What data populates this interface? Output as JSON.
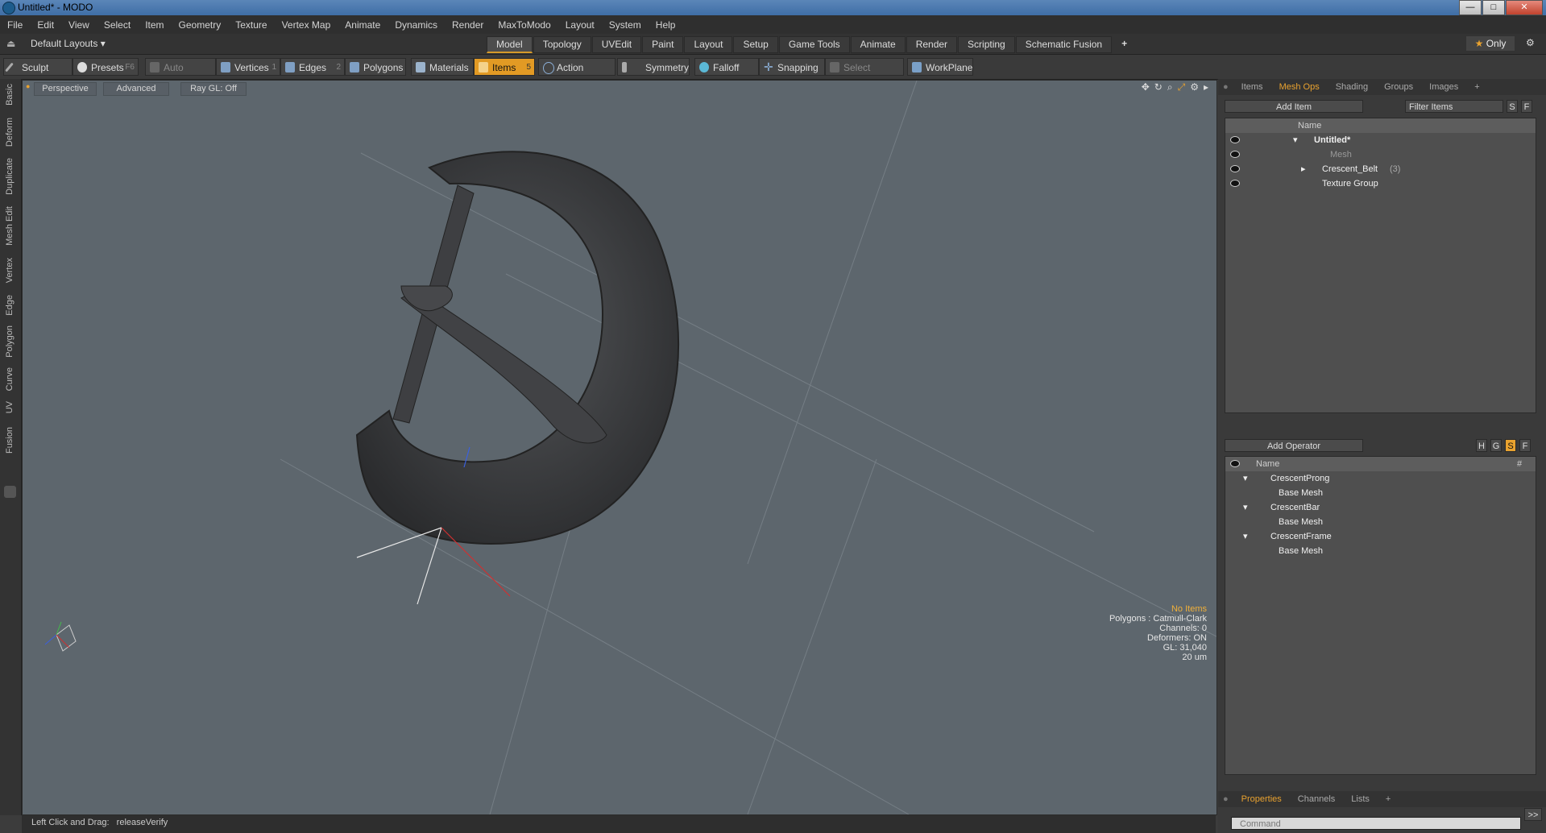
{
  "window": {
    "title": "Untitled* - MODO",
    "btn_min": "—",
    "btn_max": "□",
    "btn_close": "✕"
  },
  "menu": [
    "File",
    "Edit",
    "View",
    "Select",
    "Item",
    "Geometry",
    "Texture",
    "Vertex Map",
    "Animate",
    "Dynamics",
    "Render",
    "MaxToModo",
    "Layout",
    "System",
    "Help"
  ],
  "layout": {
    "default_layouts": "Default Layouts ▾",
    "tabs": [
      "Model",
      "Topology",
      "UVEdit",
      "Paint",
      "Layout",
      "Setup",
      "Game Tools",
      "Animate",
      "Render",
      "Scripting",
      "Schematic Fusion"
    ],
    "active_tab": "Model",
    "plus": "+",
    "only_star": "★",
    "only": "Only"
  },
  "toolbar": {
    "sculpt": "Sculpt",
    "presets": "Presets",
    "presets_key": "F6",
    "auto_select": "Auto Select",
    "vertices": "Vertices",
    "vertices_key": "1",
    "edges": "Edges",
    "edges_key": "2",
    "polygons": "Polygons",
    "materials": "Materials",
    "items": "Items",
    "items_key": "5",
    "action_center": "Action Center",
    "symmetry": "Symmetry",
    "falloff": "Falloff",
    "snapping": "Snapping",
    "select_through": "Select Through",
    "workplane": "WorkPlane"
  },
  "left_tabs": [
    "Basic",
    "Deform",
    "Duplicate",
    "Mesh Edit",
    "Vertex",
    "Edge",
    "Polygon",
    "Curve",
    "UV",
    "Fusion"
  ],
  "viewport": {
    "perspective": "Perspective",
    "advanced": "Advanced",
    "raygl": "Ray GL: Off",
    "hud": {
      "no_items": "No Items",
      "polygons": "Polygons : Catmull-Clark",
      "channels": "Channels: 0",
      "deformers": "Deformers: ON",
      "gl": "GL: 31,040",
      "scale": "20 um"
    }
  },
  "status": {
    "hint": "Left Click and Drag:",
    "action": "releaseVerify"
  },
  "items_panel": {
    "tabs": [
      "Items",
      "Mesh Ops",
      "Shading",
      "Groups",
      "Images",
      "+"
    ],
    "active_tab": "Mesh Ops",
    "add_item": "Add Item",
    "filter": "Filter Items",
    "s": "S",
    "f": "F",
    "col_name": "Name",
    "tree": [
      {
        "label": "Untitled*",
        "count": ""
      },
      {
        "label": "Mesh",
        "count": ""
      },
      {
        "label": "Crescent_Belt",
        "count": "(3)"
      },
      {
        "label": "Texture Group",
        "count": ""
      }
    ]
  },
  "meshops_panel": {
    "add_operator": "Add Operator",
    "flags": [
      "H",
      "G",
      "S",
      "F"
    ],
    "col_name": "Name",
    "col_hash": "#",
    "rows": [
      {
        "label": "CrescentProng"
      },
      {
        "label": "Base Mesh"
      },
      {
        "label": "CrescentBar"
      },
      {
        "label": "Base Mesh"
      },
      {
        "label": "CrescentFrame"
      },
      {
        "label": "Base Mesh"
      }
    ]
  },
  "props_panel": {
    "tabs": [
      "Properties",
      "Channels",
      "Lists",
      "+"
    ],
    "active_tab": "Properties",
    "expand": ">>",
    "command_placeholder": "Command"
  }
}
